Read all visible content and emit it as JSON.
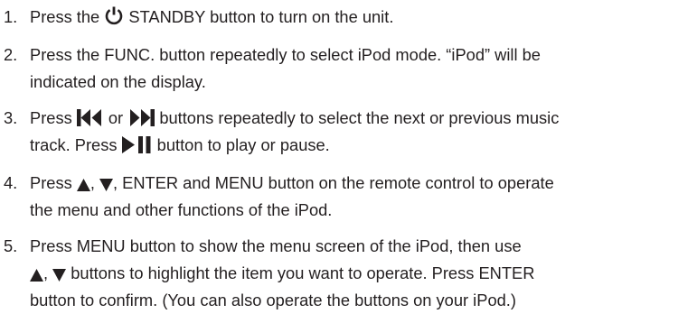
{
  "steps": [
    {
      "number": "1.",
      "lines": [
        [
          "Press the ",
          {
            "icon": "power-icon"
          },
          " STANDBY button to turn on the unit."
        ]
      ]
    },
    {
      "number": "2.",
      "lines": [
        [
          "Press the FUNC. button repeatedly to select iPod mode. “iPod” will be"
        ],
        [
          "indicated on the display."
        ]
      ]
    },
    {
      "number": "3.",
      "lines": [
        [
          "Press ",
          {
            "icon": "skip-back-icon"
          },
          " or ",
          {
            "icon": "skip-forward-icon"
          },
          " buttons repeatedly to select the next or previous music"
        ],
        [
          "track. Press ",
          {
            "icon": "play-pause-icon"
          },
          " button to play or pause."
        ]
      ]
    },
    {
      "number": "4.",
      "lines": [
        [
          "Press ",
          {
            "icon": "up-triangle-icon"
          },
          ", ",
          {
            "icon": "down-triangle-icon"
          },
          ", ENTER and MENU button on the remote control to operate"
        ],
        [
          "the menu and other functions of the iPod."
        ]
      ]
    },
    {
      "number": "5.",
      "lines": [
        [
          "Press MENU button to show the menu screen of the iPod, then use"
        ],
        [
          {
            "icon": "up-triangle-icon"
          },
          ", ",
          {
            "icon": "down-triangle-icon"
          },
          " buttons to highlight the item you want to operate. Press ENTER"
        ],
        [
          "button to confirm. (You can also operate the buttons on your iPod.)"
        ]
      ]
    }
  ],
  "colors": {
    "text": "#231f20"
  }
}
